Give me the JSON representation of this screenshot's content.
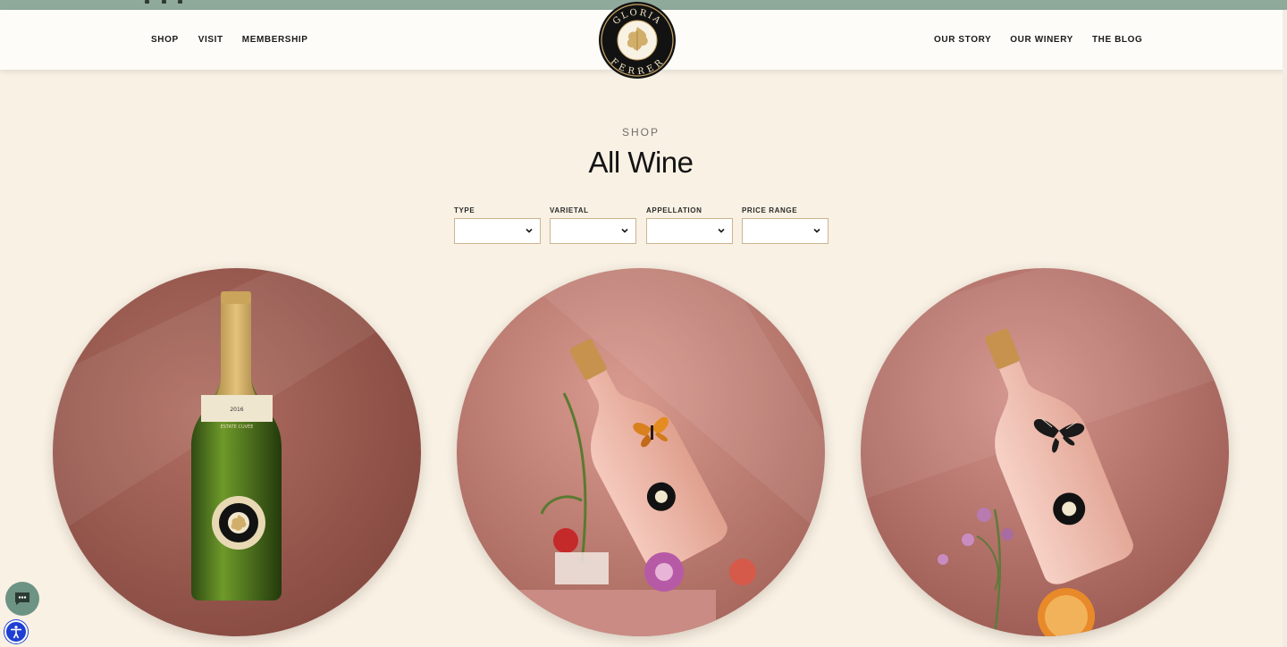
{
  "brand": {
    "logo_text_top": "GLORIA",
    "logo_text_bottom": "FERRER",
    "colors": {
      "sage_bar": "#8fa99b",
      "cream": "#f8f1e4",
      "gold": "#cdb58e",
      "logo_black": "#121212",
      "logo_gold": "#c9a766"
    }
  },
  "nav": {
    "left": [
      "SHOP",
      "VISIT",
      "MEMBERSHIP"
    ],
    "right": [
      "OUR STORY",
      "OUR WINERY",
      "THE BLOG"
    ]
  },
  "page": {
    "eyebrow": "SHOP",
    "title": "All Wine"
  },
  "filters": [
    {
      "label": "TYPE",
      "value": "",
      "icon": "chevron-down-icon"
    },
    {
      "label": "VARIETAL",
      "value": "",
      "icon": "chevron-down-icon"
    },
    {
      "label": "APPELLATION",
      "value": "",
      "icon": "chevron-down-icon"
    },
    {
      "label": "PRICE RANGE",
      "value": "",
      "icon": "chevron-down-icon"
    }
  ],
  "products": [
    {
      "image": "green sparkling wine bottle on mauve background",
      "bottle_label": "ESTATE CUVÉE",
      "vintage": "2016"
    },
    {
      "image": "rosé bottle tilted with butterfly and flowers"
    },
    {
      "image": "rosé bottle tilted with black butterfly and dried orange"
    }
  ],
  "widgets": {
    "chat": "chat-bubble-icon",
    "accessibility": "accessibility-icon"
  }
}
